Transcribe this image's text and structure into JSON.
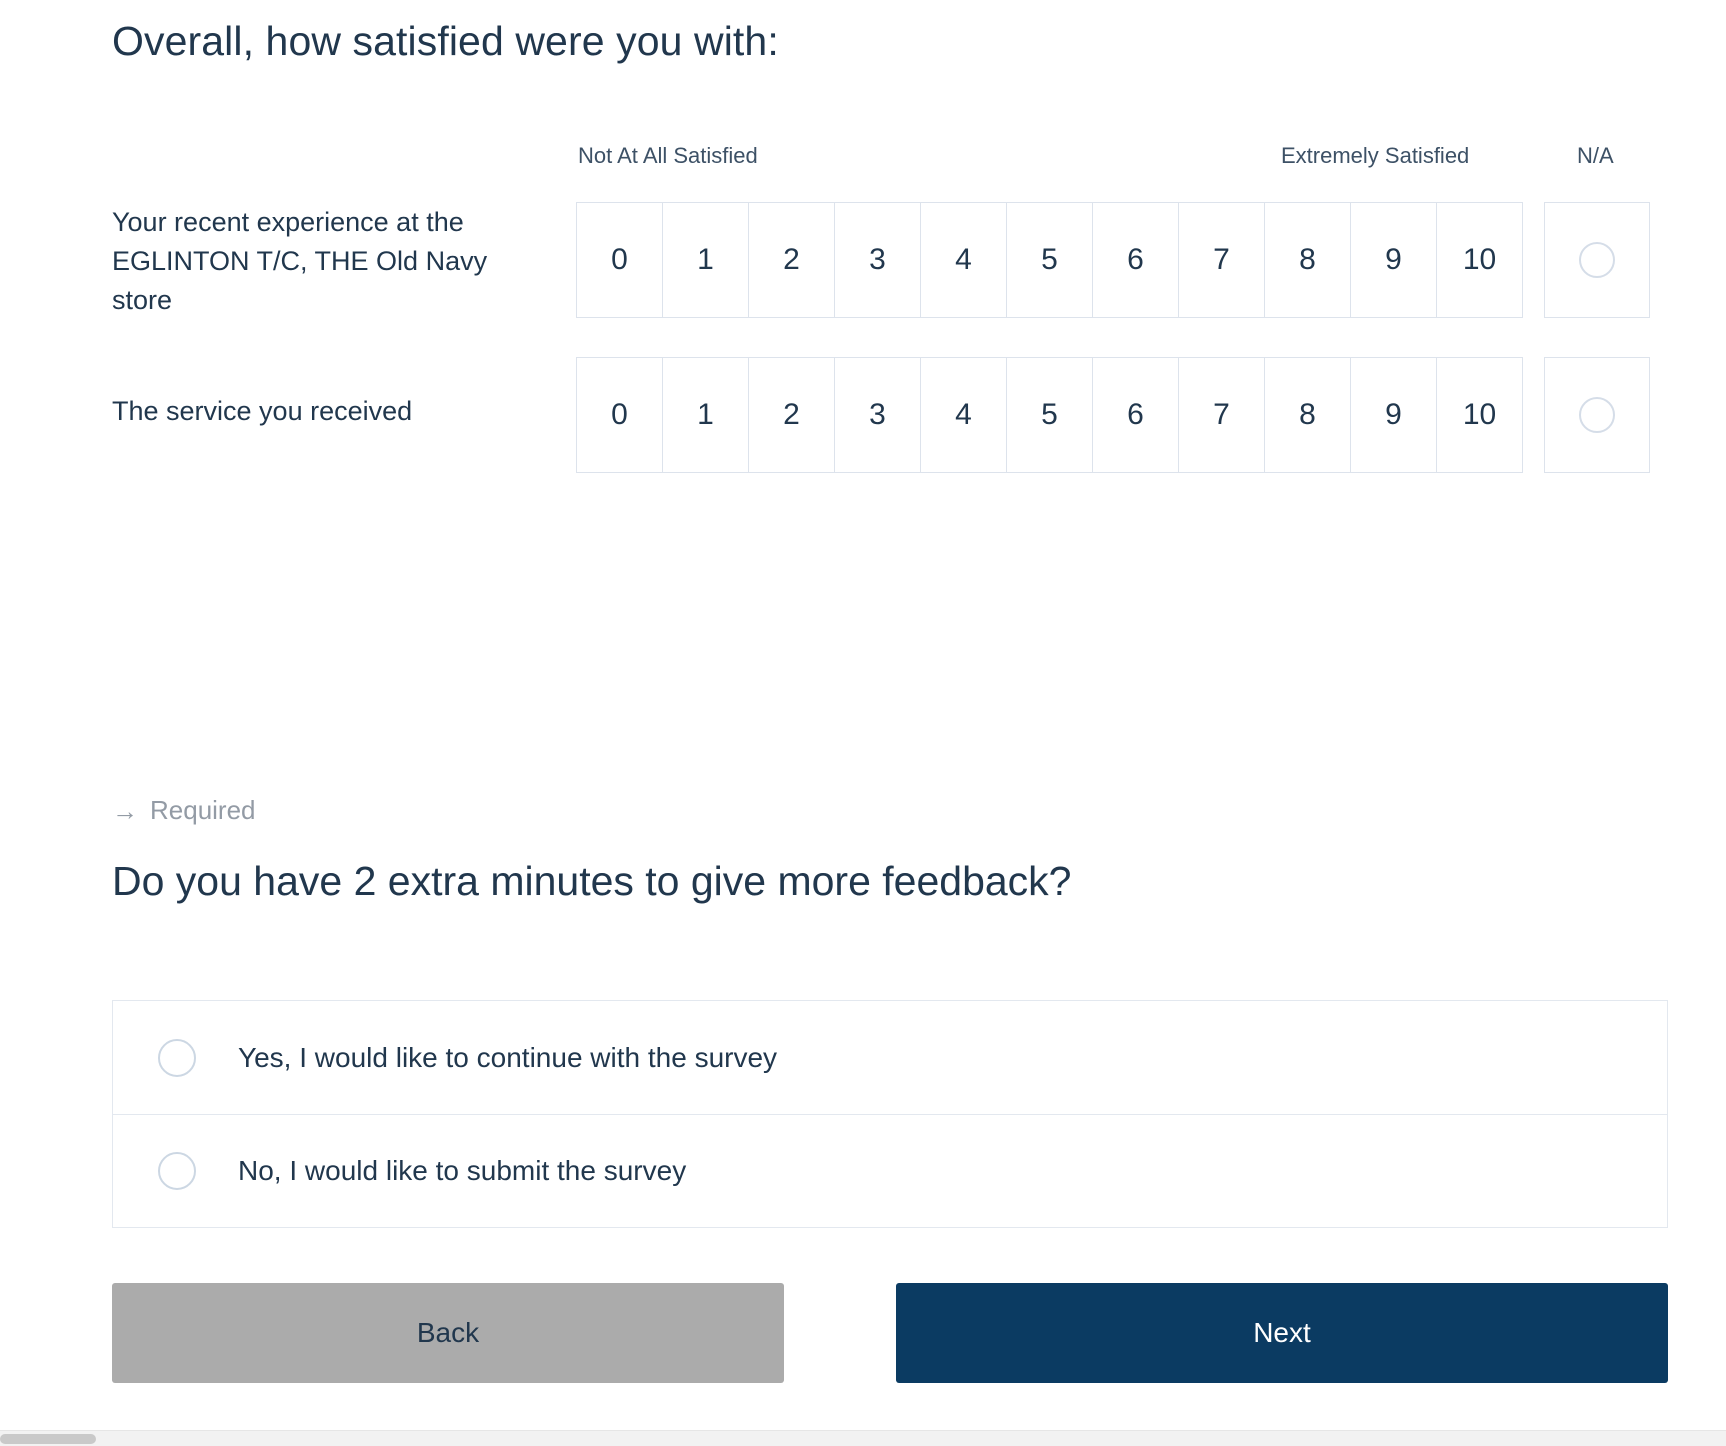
{
  "survey": {
    "question1": {
      "title": "Overall, how satisfied were you with:",
      "scale_header": {
        "low_label": "Not At All Satisfied",
        "high_label": "Extremely Satisfied",
        "na_label": "N/A"
      },
      "scale_points": [
        "0",
        "1",
        "2",
        "3",
        "4",
        "5",
        "6",
        "7",
        "8",
        "9",
        "10"
      ],
      "rows": [
        {
          "label": "Your recent experience at the EGLINTON T/C, THE Old Navy store",
          "selected": null,
          "na_selected": false
        },
        {
          "label": "The service you received",
          "selected": null,
          "na_selected": false
        }
      ]
    },
    "required_note": {
      "arrow_icon": "arrow-right-icon",
      "text": "Required"
    },
    "question2": {
      "title": "Do you have 2 extra minutes to give more feedback?",
      "options": [
        {
          "label": "Yes, I would like to continue with the survey",
          "selected": false
        },
        {
          "label": "No, I would like to submit the survey",
          "selected": false
        }
      ]
    },
    "navigation": {
      "back_label": "Back",
      "next_label": "Next"
    },
    "colors": {
      "text": "#21374d",
      "muted": "#939ba5",
      "border": "#dde3ec",
      "back_button": "#ababab",
      "next_button": "#0b3b62"
    }
  }
}
